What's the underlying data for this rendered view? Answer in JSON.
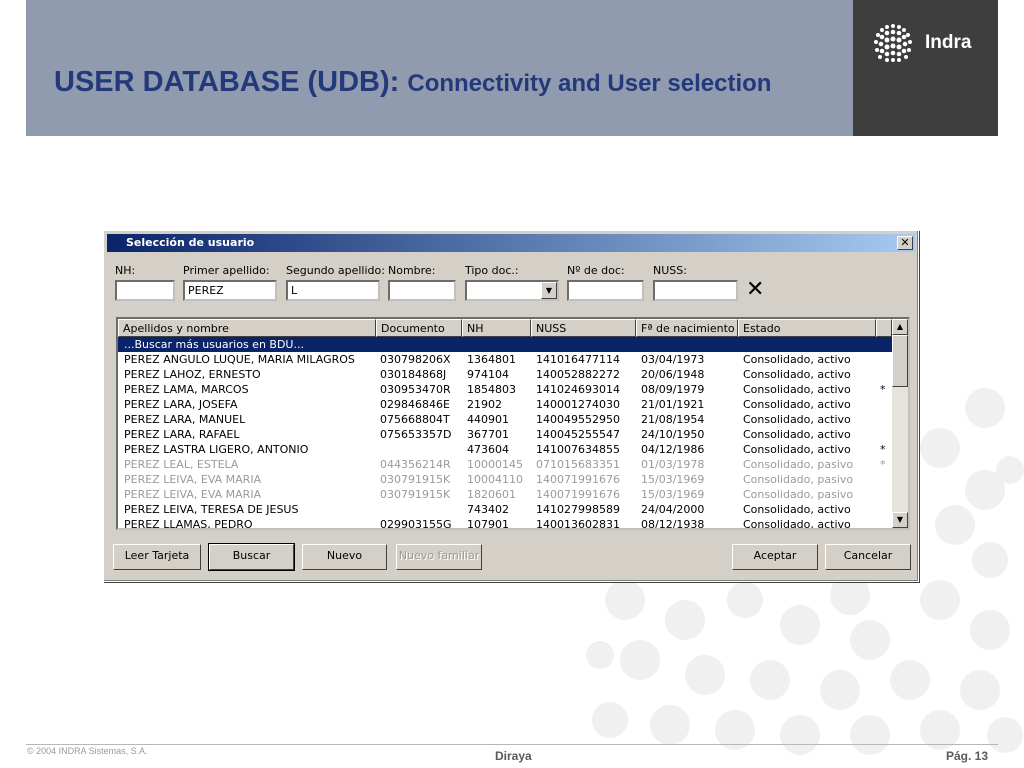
{
  "slide": {
    "title_main": "USER DATABASE (UDB): ",
    "title_sub": "Connectivity and User selection",
    "logo_text": "Indra",
    "footer_left": "© 2004 INDRA Sistemas, S.A.",
    "footer_center": "Diraya",
    "footer_right": "Pág. 13",
    "colors": {
      "header": "#919bb0",
      "title": "#24397a",
      "logo_bg": "#3e3e3e"
    }
  },
  "window": {
    "title": "Selección de usuario",
    "close_icon": "close-icon",
    "filters": {
      "nh_label": "NH:",
      "nh_value": "",
      "primer_label": "Primer apellido:",
      "primer_value": "PEREZ",
      "segundo_label": "Segundo apellido:",
      "segundo_value": "L",
      "nombre_label": "Nombre:",
      "nombre_value": "",
      "tipo_label": "Tipo doc.:",
      "tipo_value": "",
      "ndoc_label": "Nº de doc:",
      "ndoc_value": "",
      "nuss_label": "NUSS:",
      "nuss_value": "",
      "clear_glyph": "✕"
    },
    "columns": [
      "Apellidos y nombre",
      "Documento",
      "NH",
      "NUSS",
      "Fª de nacimiento",
      "Estado"
    ],
    "search_more": "...Buscar más usuarios en BDU...",
    "rows": [
      {
        "name": "PEREZ ANGULO LUQUE, MARIA MILAGROS",
        "doc": "030798206X",
        "nh": "1364801",
        "nuss": "141016477114",
        "fecha": "03/04/1973",
        "estado": "Consolidado, activo",
        "mark": "",
        "dim": false
      },
      {
        "name": "PEREZ LAHOZ, ERNESTO",
        "doc": "030184868J",
        "nh": "974104",
        "nuss": "140052882272",
        "fecha": "20/06/1948",
        "estado": "Consolidado, activo",
        "mark": "",
        "dim": false
      },
      {
        "name": "PEREZ LAMA, MARCOS",
        "doc": "030953470R",
        "nh": "1854803",
        "nuss": "141024693014",
        "fecha": "08/09/1979",
        "estado": "Consolidado, activo",
        "mark": "*",
        "dim": false
      },
      {
        "name": "PEREZ LARA, JOSEFA",
        "doc": "029846846E",
        "nh": "21902",
        "nuss": "140001274030",
        "fecha": "21/01/1921",
        "estado": "Consolidado, activo",
        "mark": "",
        "dim": false
      },
      {
        "name": "PEREZ LARA, MANUEL",
        "doc": "075668804T",
        "nh": "440901",
        "nuss": "140049552950",
        "fecha": "21/08/1954",
        "estado": "Consolidado, activo",
        "mark": "",
        "dim": false
      },
      {
        "name": "PEREZ LARA, RAFAEL",
        "doc": "075653357D",
        "nh": "367701",
        "nuss": "140045255547",
        "fecha": "24/10/1950",
        "estado": "Consolidado, activo",
        "mark": "",
        "dim": false
      },
      {
        "name": "PEREZ LASTRA LIGERO, ANTONIO",
        "doc": "",
        "nh": "473604",
        "nuss": "141007634855",
        "fecha": "04/12/1986",
        "estado": "Consolidado, activo",
        "mark": "*",
        "dim": false
      },
      {
        "name": "PEREZ LEAL, ESTELA",
        "doc": "044356214R",
        "nh": "10000145",
        "nuss": "071015683351",
        "fecha": "01/03/1978",
        "estado": "Consolidado, pasivo",
        "mark": "*",
        "dim": true
      },
      {
        "name": "PEREZ LEIVA, EVA MARIA",
        "doc": "030791915K",
        "nh": "10004110",
        "nuss": "140071991676",
        "fecha": "15/03/1969",
        "estado": "Consolidado, pasivo",
        "mark": "",
        "dim": true
      },
      {
        "name": "PEREZ LEIVA, EVA MARIA",
        "doc": "030791915K",
        "nh": "1820601",
        "nuss": "140071991676",
        "fecha": "15/03/1969",
        "estado": "Consolidado, pasivo",
        "mark": "",
        "dim": true
      },
      {
        "name": "PEREZ LEIVA, TERESA DE JESUS",
        "doc": "",
        "nh": "743402",
        "nuss": "141027998589",
        "fecha": "24/04/2000",
        "estado": "Consolidado, activo",
        "mark": "",
        "dim": false
      },
      {
        "name": "PEREZ LLAMAS, PEDRO",
        "doc": "029903155G",
        "nh": "107901",
        "nuss": "140013602831",
        "fecha": "08/12/1938",
        "estado": "Consolidado, activo",
        "mark": "",
        "dim": false
      }
    ],
    "buttons": {
      "leer": "Leer Tarjeta",
      "buscar": "Buscar",
      "nuevo": "Nuevo",
      "nuevo_familiar": "Nuevo familiar",
      "aceptar": "Aceptar",
      "cancelar": "Cancelar"
    }
  }
}
